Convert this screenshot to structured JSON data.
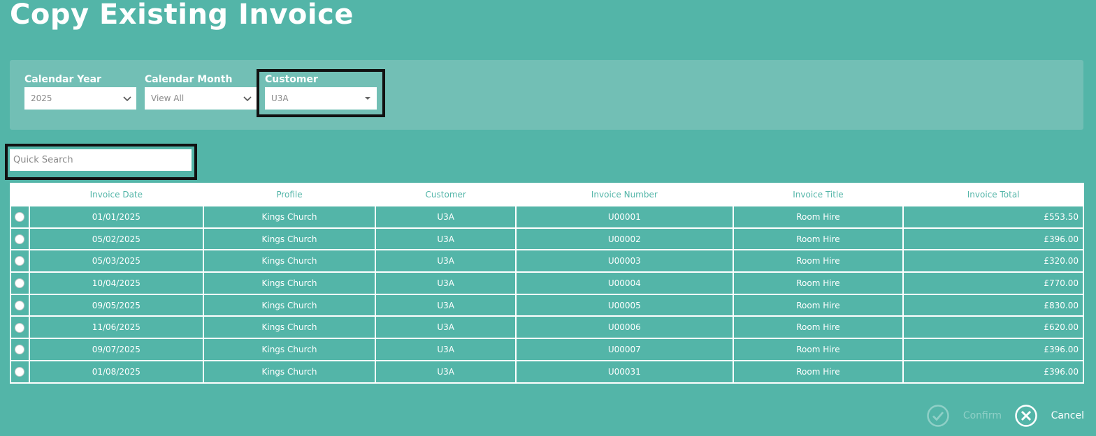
{
  "page": {
    "title": "Copy Existing Invoice"
  },
  "filters": {
    "year": {
      "label": "Calendar Year",
      "value": "2025"
    },
    "month": {
      "label": "Calendar Month",
      "value": "View All"
    },
    "customer": {
      "label": "Customer",
      "value": "U3A"
    }
  },
  "search": {
    "placeholder": "Quick Search"
  },
  "table": {
    "headers": {
      "date": "Invoice Date",
      "profile": "Profile",
      "customer": "Customer",
      "number": "Invoice Number",
      "title": "Invoice Title",
      "total": "Invoice Total"
    },
    "rows": [
      {
        "date": "01/01/2025",
        "profile": "Kings Church",
        "customer": "U3A",
        "number": "U00001",
        "title": "Room Hire",
        "total": "£553.50"
      },
      {
        "date": "05/02/2025",
        "profile": "Kings Church",
        "customer": "U3A",
        "number": "U00002",
        "title": "Room Hire",
        "total": "£396.00"
      },
      {
        "date": "05/03/2025",
        "profile": "Kings Church",
        "customer": "U3A",
        "number": "U00003",
        "title": "Room Hire",
        "total": "£320.00"
      },
      {
        "date": "10/04/2025",
        "profile": "Kings Church",
        "customer": "U3A",
        "number": "U00004",
        "title": "Room Hire",
        "total": "£770.00"
      },
      {
        "date": "09/05/2025",
        "profile": "Kings Church",
        "customer": "U3A",
        "number": "U00005",
        "title": "Room Hire",
        "total": "£830.00"
      },
      {
        "date": "11/06/2025",
        "profile": "Kings Church",
        "customer": "U3A",
        "number": "U00006",
        "title": "Room Hire",
        "total": "£620.00"
      },
      {
        "date": "09/07/2025",
        "profile": "Kings Church",
        "customer": "U3A",
        "number": "U00007",
        "title": "Room Hire",
        "total": "£396.00"
      },
      {
        "date": "01/08/2025",
        "profile": "Kings Church",
        "customer": "U3A",
        "number": "U00031",
        "title": "Room Hire",
        "total": "£396.00"
      }
    ]
  },
  "actions": {
    "confirm": {
      "label": "Confirm",
      "icon": "check-circle-icon"
    },
    "cancel": {
      "label": "Cancel",
      "icon": "close-circle-icon"
    }
  },
  "colors": {
    "background": "#53b5a8",
    "panel": "#72bfb5",
    "highlight_border": "#111111"
  }
}
